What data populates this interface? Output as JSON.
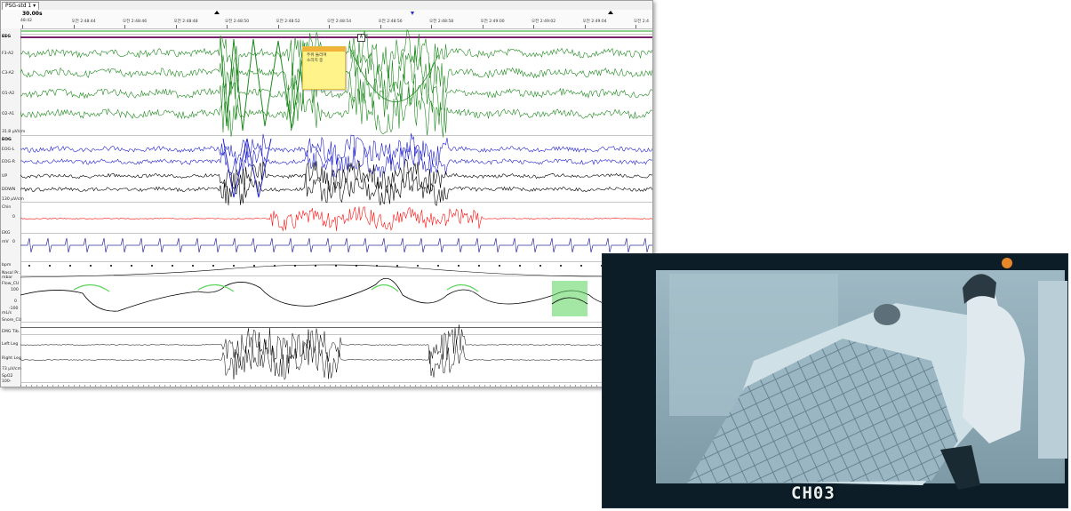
{
  "psg_window": {
    "montage_label": "PSG-std 1 ▾",
    "epoch_length": "30.00s",
    "time_ticks": [
      "48:42",
      "오전 2:48:44",
      "오전 2:48:46",
      "오전 2:48:48",
      "오전 2:48:50",
      "오전 2:48:52",
      "오전 2:48:54",
      "오전 2:48:56",
      "오전 2:48:58",
      "오전 2:49:00",
      "오전 2:49:02",
      "오전 2:49:04",
      "오전 2:4"
    ],
    "channels": {
      "eeg": "EEG",
      "f3": "F3-A2",
      "c3": "C3-A2",
      "o1": "O1-A2",
      "o2": "O2-A1",
      "eeg_scale": "31.8 µV/cm",
      "eog": "EOG",
      "eogl": "EOG-L",
      "eogr": "EOG-R",
      "up": "UP",
      "down": "DOWN",
      "eog_scale": "130 µV/cm",
      "chin": "Chin",
      "ekg": "EKG",
      "ekg_unit": "mV",
      "bpm": "bpm",
      "nasal": "Nasal Pr..",
      "mbar": "mbar",
      "flow": "Flow_CU",
      "mls": "mL/s",
      "snore": "Snore_CU",
      "emg": "EMG Tib.",
      "left_leg": "Left Leg",
      "right_leg": "Right Leg",
      "leg_scale": "73 µV/cm",
      "spo2": "SpO2",
      "spo2_scale": "100-"
    },
    "scale_values": {
      "chin_zero": "0",
      "ekg_zero": "0",
      "flow_100": "100",
      "flow_zero": "0",
      "flow_neg": "-100"
    },
    "annotation_note": "주위 둘러며\n소리치 중",
    "event_marker": "A",
    "colors": {
      "eeg": "#1e8a1e",
      "eog": "#2020d0",
      "chin": "#ff1010",
      "ekg": "#3030a0",
      "flow_highlight": "#5ad45a",
      "leg": "#000000",
      "note": "#fff38a"
    }
  },
  "video": {
    "camera_label": "CH03"
  }
}
